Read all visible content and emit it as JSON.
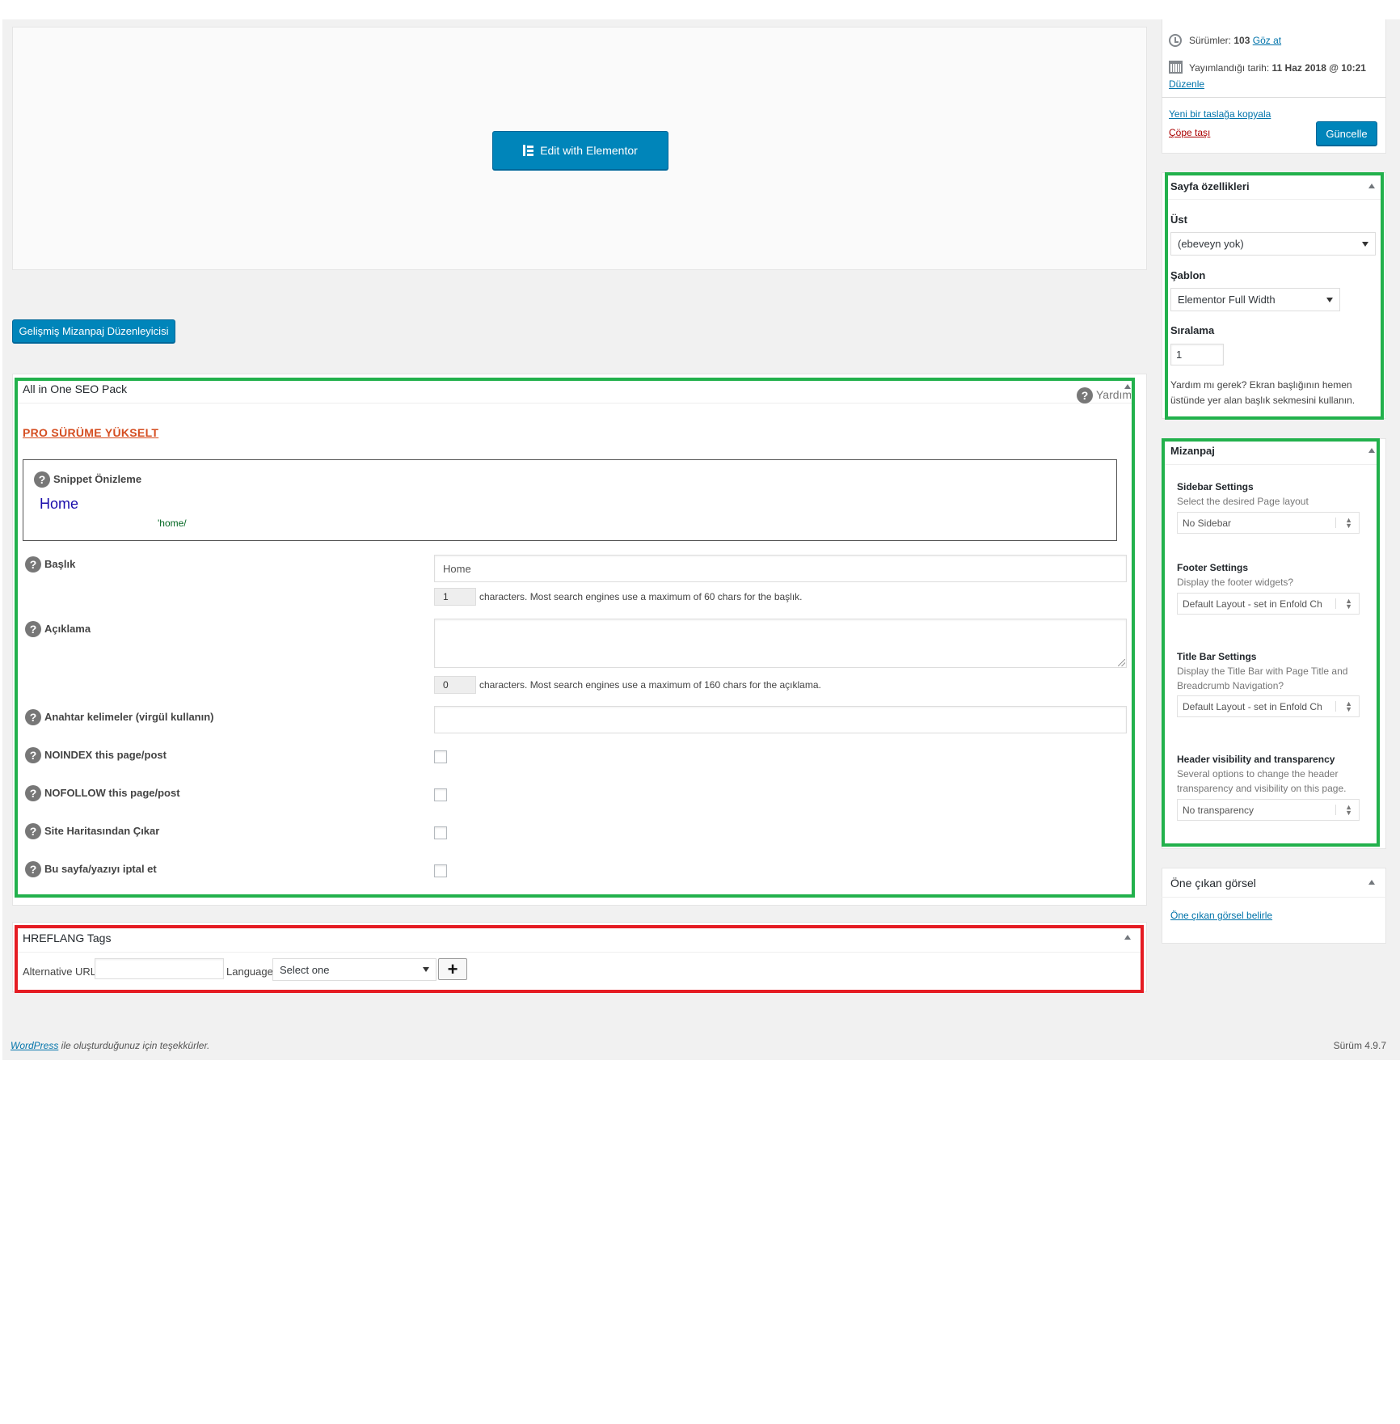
{
  "editor": {
    "elementor_button": "Edit with Elementor",
    "advanced_layout_button": "Gelişmiş Mizanpaj Düzenleyicisi"
  },
  "publish": {
    "revisions_label": "Sürümler:",
    "revisions_count": "103",
    "revisions_link": "Göz at",
    "published_label": "Yayımlandığı tarih:",
    "published_date": "11 Haz 2018 @ 10:21",
    "edit_link": "Düzenle",
    "copy_link": "Yeni bir taslağa kopyala",
    "trash_link": "Çöpe taşı",
    "update_button": "Güncelle"
  },
  "page_attributes": {
    "title": "Sayfa özellikleri",
    "parent_label": "Üst",
    "parent_value": "(ebeveyn yok)",
    "template_label": "Şablon",
    "template_value": "Elementor Full Width",
    "order_label": "Sıralama",
    "order_value": "1",
    "help_text": "Yardım mı gerek? Ekran başlığının hemen üstünde yer alan başlık sekmesini kullanın."
  },
  "layout": {
    "title": "Mizanpaj",
    "sections": [
      {
        "heading": "Sidebar Settings",
        "desc": "Select the desired Page layout",
        "value": "No Sidebar"
      },
      {
        "heading": "Footer Settings",
        "desc": "Display the footer widgets?",
        "value": "Default Layout - set in Enfold Ch"
      },
      {
        "heading": "Title Bar Settings",
        "desc": "Display the Title Bar with Page Title and Breadcrumb Navigation?",
        "value": "Default Layout - set in Enfold Ch"
      },
      {
        "heading": "Header visibility and transparency",
        "desc": "Several options to change the header transparency and visibility on this page.",
        "value": "No transparency"
      }
    ]
  },
  "featured_image": {
    "title": "Öne çıkan görsel",
    "set_link": "Öne çıkan görsel belirle"
  },
  "seo": {
    "title": "All in One SEO Pack",
    "help_label": "Yardım",
    "pro_link": "PRO SÜRÜME YÜKSELT",
    "snippet_label": "Snippet Önizleme",
    "snippet_title": "Home",
    "snippet_url": "'home/",
    "title_label": "Başlık",
    "title_placeholder": "Home",
    "title_count": "1",
    "title_hint": "characters. Most search engines use a maximum of 60 chars for the başlık.",
    "desc_label": "Açıklama",
    "desc_count": "0",
    "desc_hint": "characters. Most search engines use a maximum of 160 chars for the açıklama.",
    "keywords_label": "Anahtar kelimeler (virgül kullanın)",
    "noindex_label": "NOINDEX this page/post",
    "nofollow_label": "NOFOLLOW this page/post",
    "sitemap_label": "Site Haritasından Çıkar",
    "disable_label": "Bu sayfa/yazıyı iptal et"
  },
  "hreflang": {
    "title": "HREFLANG Tags",
    "alt_url_label": "Alternative URL",
    "language_label": "Language",
    "language_value": "Select one",
    "add_button": "+"
  },
  "footer": {
    "wp_link": "WordPress",
    "thanks_text": " ile oluşturduğunuz için teşekkürler.",
    "version": "Sürüm 4.9.7"
  },
  "colors": {
    "primary_button": "#0085ba",
    "highlight_green": "#22b14c",
    "highlight_red": "#e51c23",
    "pro_link": "#d54e21",
    "trash_link": "#a00",
    "snippet_title": "#1a0dab",
    "snippet_url": "#006621"
  },
  "icons": {
    "elementor": "elementor-icon",
    "revisions": "history-icon",
    "calendar": "calendar-icon",
    "help": "help-icon",
    "toggle": "toggle-arrow-icon"
  }
}
